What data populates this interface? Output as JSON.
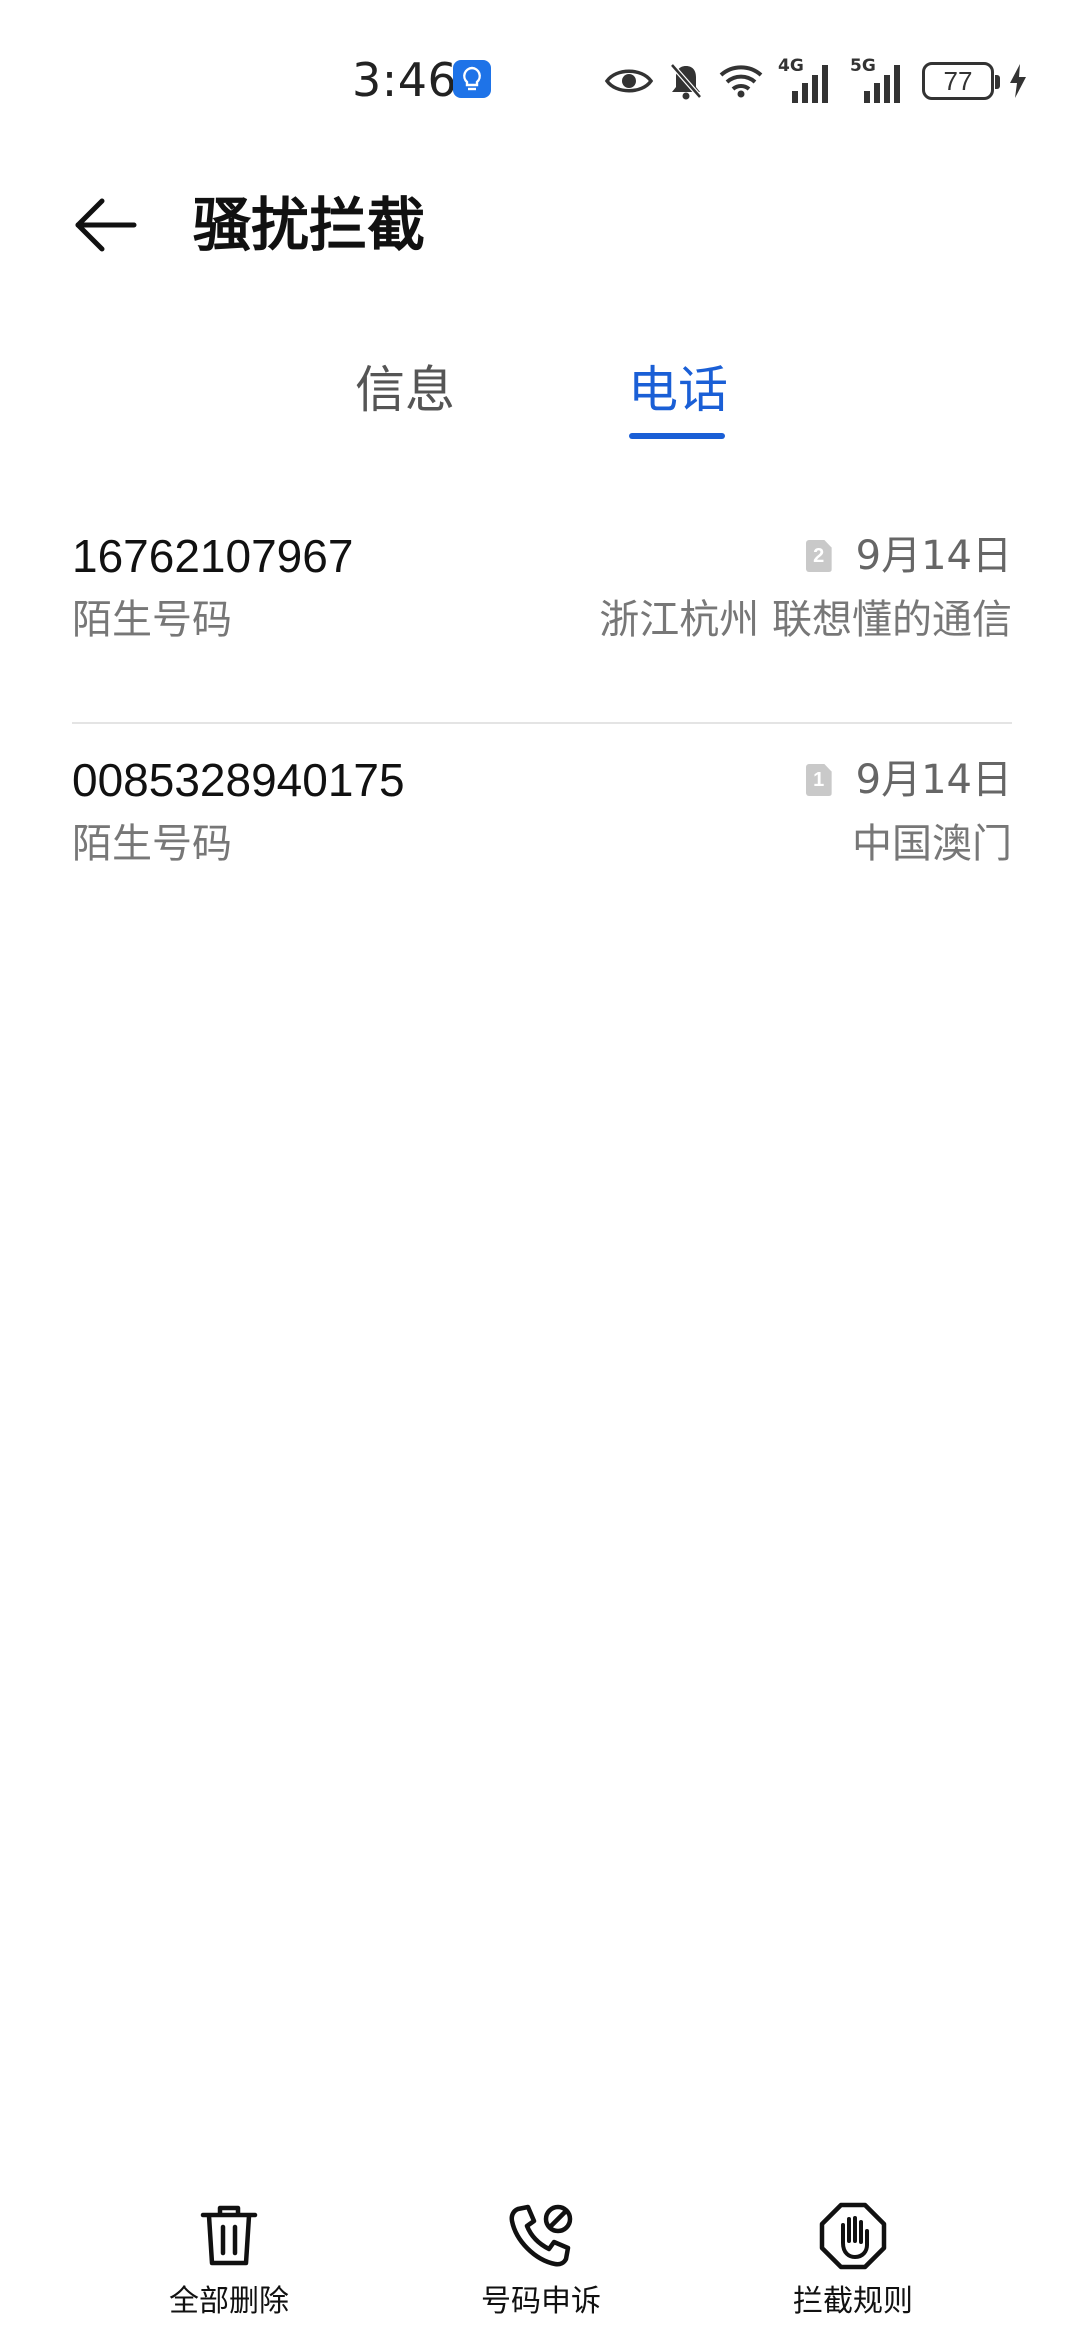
{
  "status_bar": {
    "time": "3:46",
    "network1": "4G",
    "network2": "5G",
    "battery": "77"
  },
  "header": {
    "title": "骚扰拦截"
  },
  "tabs": [
    {
      "label": "信息",
      "active": false
    },
    {
      "label": "电话",
      "active": true
    }
  ],
  "calls": [
    {
      "number": "16762107967",
      "type": "陌生号码",
      "sim": "2",
      "date": "9月14日",
      "location": "浙江杭州 联想懂的通信"
    },
    {
      "number": "0085328940175",
      "type": "陌生号码",
      "sim": "1",
      "date": "9月14日",
      "location": "中国澳门"
    }
  ],
  "toolbar": {
    "delete_all": "全部删除",
    "number_appeal": "号码申诉",
    "block_rules": "拦截规则"
  },
  "colors": {
    "accent": "#1a5fd6",
    "text": "#111111",
    "secondary_text": "#777777",
    "divider": "#e4e4e4"
  },
  "icons": {
    "back": "arrow-left-icon",
    "delete": "trash-icon",
    "appeal": "phone-blocked-icon",
    "rules": "hand-stop-icon"
  }
}
